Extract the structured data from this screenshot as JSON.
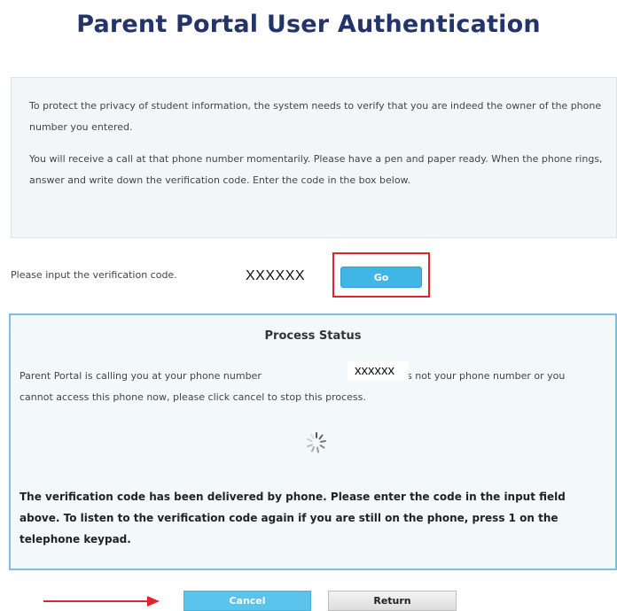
{
  "page": {
    "title": "Parent Portal User Authentication"
  },
  "info": {
    "paragraph1": "To protect the privacy of student information, the system needs to verify that you are indeed the owner of the phone number you entered.",
    "paragraph2": "You will receive a call at that phone number momentarily. Please have a pen and paper ready. When the phone rings, answer and write down the verification code. Enter the code in the box below."
  },
  "verification": {
    "label": "Please input the verification code.",
    "code_value": "XXXXXX",
    "go_label": "Go"
  },
  "status": {
    "title": "Process Status",
    "calling_text": "Parent Portal is calling you at your phone number",
    "phone_value": "xxxxxx",
    "calling_text_rest": "If this is not your phone number or you cannot access this phone now, please click cancel to stop this process.",
    "delivered_text": "The verification code has been delivered by phone. Please enter the code in the input field above. To listen to the verification code again if you are still on the phone, press 1 on the telephone keypad."
  },
  "actions": {
    "cancel_label": "Cancel",
    "return_label": "Return"
  },
  "colors": {
    "title": "#22346a",
    "go_button": "#41b6e6",
    "highlight": "#e0242a",
    "status_border": "#7cc0de",
    "arrow": "#e0242a"
  },
  "icons": {
    "spinner": "loading-spinner-icon",
    "arrow": "right-arrow-icon"
  }
}
